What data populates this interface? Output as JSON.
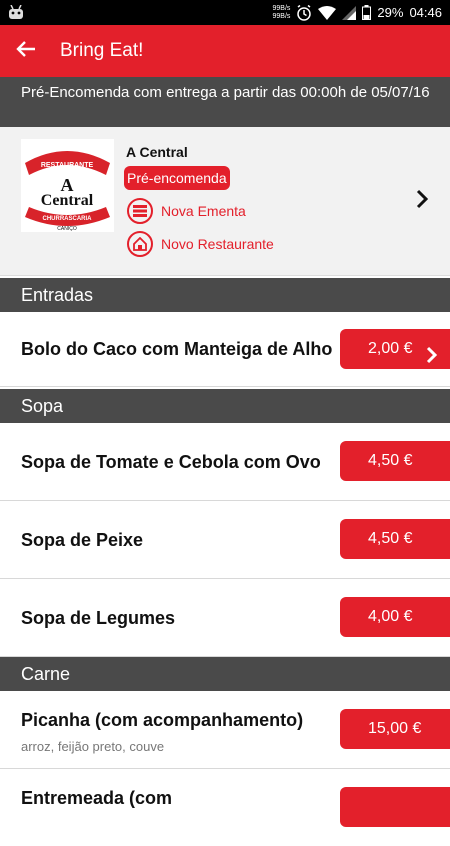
{
  "status_bar": {
    "net_up": "99B/s",
    "net_down": "99B/s",
    "battery": "29%",
    "time": "04:46"
  },
  "app_bar": {
    "title": "Bring Eat!"
  },
  "banner": {
    "text": "Pré-Encomenda com entrega a partir das 00:00h de 05/07/16"
  },
  "restaurant": {
    "name": "A Central",
    "badge": "Pré-encomenda",
    "tag1": "Nova Ementa",
    "tag2": "Novo Restaurante",
    "logo_text": "Restaurante A Central Churrascaria Caniço"
  },
  "sections": {
    "entradas": "Entradas",
    "sopa": "Sopa",
    "carne": "Carne"
  },
  "items": [
    {
      "name": "Bolo do Caco com Manteiga de Alho",
      "price": "2,00 €"
    },
    {
      "name": "Sopa de Tomate e Cebola com Ovo",
      "price": "4,50 €"
    },
    {
      "name": "Sopa de Peixe",
      "price": "4,50 €"
    },
    {
      "name": "Sopa de Legumes",
      "price": "4,00 €"
    },
    {
      "name": "Picanha (com acompanhamento)",
      "desc": "arroz, feijão preto, couve",
      "price": "15,00 €"
    },
    {
      "name": "Entremeada (com"
    }
  ],
  "colors": {
    "accent": "#e3202b",
    "section": "#4a4a4a"
  }
}
